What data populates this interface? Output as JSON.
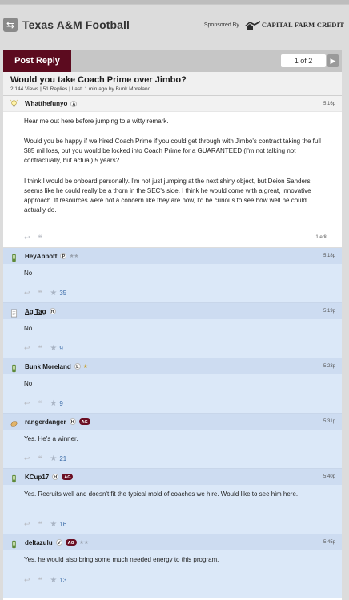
{
  "header": {
    "board_title": "Texas A&M Football",
    "sponsor_label": "Sponsored By",
    "sponsor_name": "CAPITAL FARM CREDIT"
  },
  "actions": {
    "post_reply": "Post Reply",
    "page_indicator": "1 of 2",
    "next_icon": "chevron-right"
  },
  "topic": {
    "title": "Would you take Coach Prime over Jimbo?",
    "meta": "2,144 Views | 51 Replies | Last: 1 min ago by Bunk Moreland"
  },
  "original_post": {
    "username": "Whatthefunyo",
    "badge": "A",
    "time": "5:16p",
    "paragraphs": [
      "Hear me out here before jumping to a witty remark.",
      "Would you be happy if we hired Coach Prime if you could get through with Jimbo's contract taking the full $85 mil loss, but you would be locked into Coach Prime for a GUARANTEED (I'm not talking not contractually, but actual) 5 years?",
      "I think I would be onboard personally. I'm not just jumping at the next shiny object, but Deion Sanders seems like he could really be a thorn in the SEC's side. I think he would come with a great, innovative approach. If resources were not a concern like they are now, I'd be curious to see how well he could actually do."
    ],
    "edit_note": "1 edit",
    "icon": "lightbulb-icon"
  },
  "replies": [
    {
      "username": "HeyAbbott",
      "badge": "P",
      "ag": "",
      "stars_on": 0,
      "stars_off": 2,
      "time": "5:18p",
      "text": "No",
      "likes": "35",
      "icon": "phone-icon",
      "linked": false
    },
    {
      "username": "Ag Tag",
      "badge": "H",
      "ag": "",
      "stars_on": 0,
      "stars_off": 0,
      "time": "5:19p",
      "text": "No.",
      "likes": "9",
      "icon": "document-icon",
      "linked": true
    },
    {
      "username": "Bunk Moreland",
      "badge": "L",
      "ag": "",
      "stars_on": 1,
      "stars_off": 0,
      "time": "5:23p",
      "text": "No",
      "likes": "9",
      "icon": "phone-icon",
      "linked": false
    },
    {
      "username": "rangerdanger",
      "badge": "H",
      "ag": "AG",
      "stars_on": 0,
      "stars_off": 0,
      "time": "5:31p",
      "text": "Yes. He's a winner.",
      "likes": "21",
      "icon": "hand-icon",
      "linked": false
    },
    {
      "username": "KCup17",
      "badge": "H",
      "ag": "AG",
      "stars_on": 0,
      "stars_off": 0,
      "time": "5:40p",
      "text": "Yes. Recruits well and doesn't fit the typical mold of coaches we hire. Would like to see him here.",
      "likes": "16",
      "icon": "phone-icon",
      "linked": false
    },
    {
      "username": "deltazulu",
      "badge": "V",
      "ag": "AG",
      "stars_on": 0,
      "stars_off": 2,
      "time": "5:45p",
      "text": "Yes, he would also bring some much needed energy to this program.",
      "likes": "13",
      "icon": "phone-icon",
      "linked": false
    }
  ],
  "colors": {
    "maroon": "#5c0b1f",
    "reply_bg": "#dbe8f8",
    "like_count": "#3c6ca8",
    "star_gold": "#c8a02a"
  }
}
